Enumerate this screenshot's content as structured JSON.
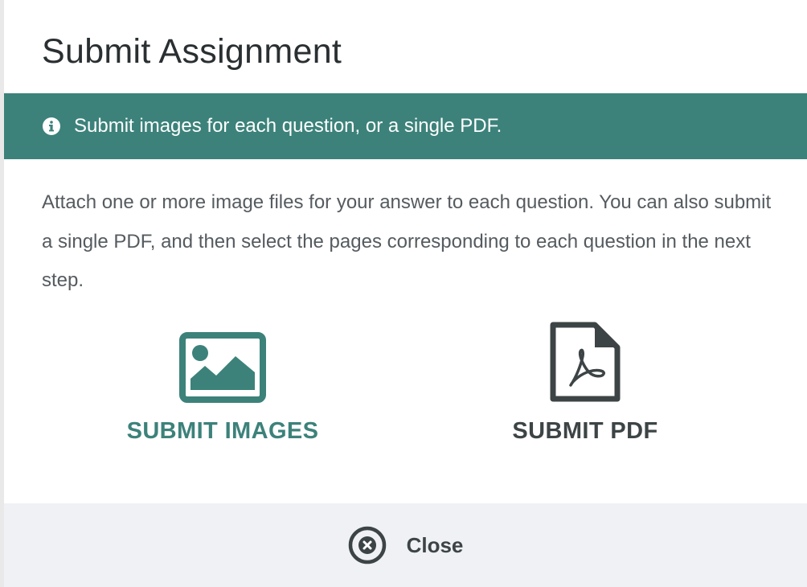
{
  "modal": {
    "title": "Submit Assignment",
    "banner": {
      "icon": "info-circle-icon",
      "text": "Submit images for each question, or a single PDF."
    },
    "description": "Attach one or more image files for your answer to each question. You can also submit a single PDF, and then select the pages corresponding to each question in the next step.",
    "options": [
      {
        "icon": "image-icon",
        "label": "SUBMIT IMAGES",
        "color": "#3c827a"
      },
      {
        "icon": "pdf-file-icon",
        "label": "SUBMIT PDF",
        "color": "#3d4446"
      }
    ],
    "footer": {
      "close_icon": "close-circle-icon",
      "close_label": "Close"
    }
  },
  "colors": {
    "accent": "#3c827a",
    "text_dark": "#2a2f31",
    "text_body": "#555b5f",
    "footer_bg": "#f0f1f4"
  }
}
